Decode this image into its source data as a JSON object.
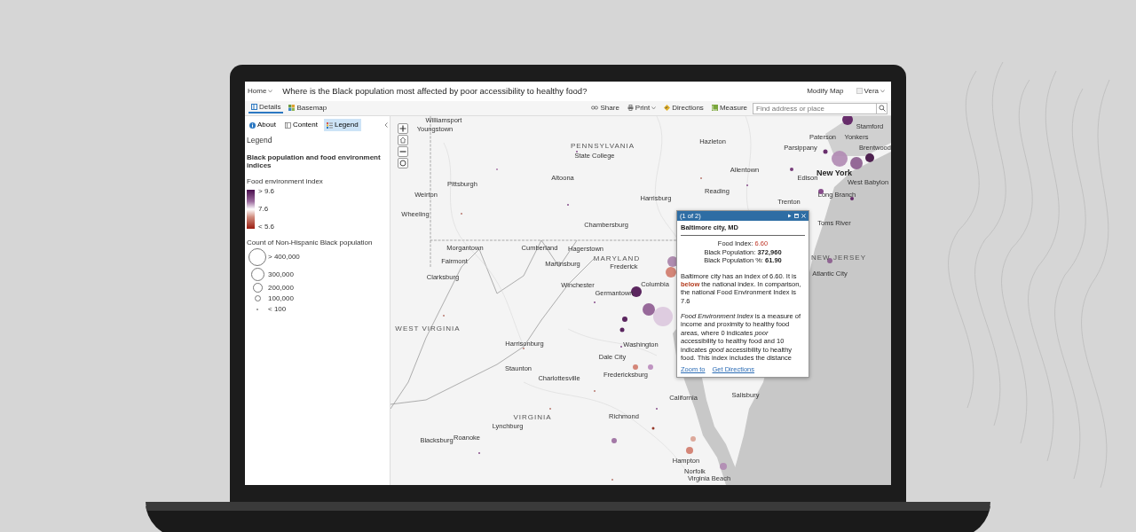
{
  "header": {
    "home": "Home",
    "title": "Where is the Black population most affected by poor accessibility to healthy food?",
    "modify": "Modify Map",
    "user": "Vera"
  },
  "toolbar": {
    "tabs": [
      {
        "label": "Details",
        "kind": "details",
        "selected": true
      },
      {
        "label": "Basemap",
        "kind": "basemap",
        "selected": false
      }
    ],
    "actions": [
      {
        "label": "Share",
        "kind": "share",
        "menu": false
      },
      {
        "label": "Print",
        "kind": "print",
        "menu": true
      },
      {
        "label": "Directions",
        "kind": "directions",
        "menu": false
      },
      {
        "label": "Measure",
        "kind": "measure",
        "menu": false
      }
    ],
    "search": {
      "placeholder": "Find address or place"
    }
  },
  "panel": {
    "tabs": [
      {
        "label": "About",
        "kind": "about",
        "selected": false
      },
      {
        "label": "Content",
        "kind": "content",
        "selected": false
      },
      {
        "label": "Legend",
        "kind": "legend",
        "selected": true
      }
    ],
    "heading": "Legend",
    "layer": "Black population and food environment indices",
    "ramp_title": "Food environment index",
    "ramp_labels": [
      "> 9.6",
      "7.6",
      "< 5.6"
    ],
    "size_title": "Count of Non-Hispanic Black population",
    "sizes": [
      "> 400,000",
      "300,000",
      "200,000",
      "100,000",
      "< 100"
    ]
  },
  "map": {
    "labels": [
      {
        "text": "Williamsport",
        "kind": "city"
      },
      {
        "text": "Stamford",
        "kind": "city"
      },
      {
        "text": "Youngstown",
        "kind": "city"
      },
      {
        "text": "Paterson",
        "kind": "city"
      },
      {
        "text": "Yonkers",
        "kind": "city"
      },
      {
        "text": "Hazleton",
        "kind": "city"
      },
      {
        "text": "PENNSYLVANIA",
        "kind": "state"
      },
      {
        "text": "Parsippany",
        "kind": "city"
      },
      {
        "text": "Brentwood",
        "kind": "city"
      },
      {
        "text": "State College",
        "kind": "city"
      },
      {
        "text": "Allentown",
        "kind": "city"
      },
      {
        "text": "West Babylon",
        "kind": "city"
      },
      {
        "text": "New York",
        "kind": "major"
      },
      {
        "text": "Altoona",
        "kind": "city"
      },
      {
        "text": "Edison",
        "kind": "city"
      },
      {
        "text": "Pittsburgh",
        "kind": "city"
      },
      {
        "text": "Reading",
        "kind": "city"
      },
      {
        "text": "Weirton",
        "kind": "city"
      },
      {
        "text": "Long Branch",
        "kind": "city"
      },
      {
        "text": "Harrisburg",
        "kind": "city"
      },
      {
        "text": "Trenton",
        "kind": "city"
      },
      {
        "text": "Wheeling",
        "kind": "city"
      },
      {
        "text": "Toms River",
        "kind": "city"
      },
      {
        "text": "Chambersburg",
        "kind": "city"
      },
      {
        "text": "Morgantown",
        "kind": "city"
      },
      {
        "text": "Cumberland",
        "kind": "city"
      },
      {
        "text": "Hagerstown",
        "kind": "city"
      },
      {
        "text": "NEW JERSEY",
        "kind": "state"
      },
      {
        "text": "MARYLAND",
        "kind": "state"
      },
      {
        "text": "Fairmont",
        "kind": "city"
      },
      {
        "text": "Martinsburg",
        "kind": "city"
      },
      {
        "text": "Frederick",
        "kind": "city"
      },
      {
        "text": "Atlantic City",
        "kind": "city"
      },
      {
        "text": "Clarksburg",
        "kind": "city"
      },
      {
        "text": "Columbia",
        "kind": "city"
      },
      {
        "text": "Winchester",
        "kind": "city"
      },
      {
        "text": "Germantown",
        "kind": "city"
      },
      {
        "text": "WEST VIRGINIA",
        "kind": "state"
      },
      {
        "text": "Washington",
        "kind": "city"
      },
      {
        "text": "Dale City",
        "kind": "city"
      },
      {
        "text": "Harrisonburg",
        "kind": "city"
      },
      {
        "text": "Fredericksburg",
        "kind": "city"
      },
      {
        "text": "Staunton",
        "kind": "city"
      },
      {
        "text": "Charlottesville",
        "kind": "city"
      },
      {
        "text": "Salisbury",
        "kind": "city"
      },
      {
        "text": "California",
        "kind": "city"
      },
      {
        "text": "Richmond",
        "kind": "city"
      },
      {
        "text": "VIRGINIA",
        "kind": "state"
      },
      {
        "text": "Lynchburg",
        "kind": "city"
      },
      {
        "text": "Roanoke",
        "kind": "city"
      },
      {
        "text": "Blacksburg",
        "kind": "city"
      },
      {
        "text": "Hampton",
        "kind": "city"
      },
      {
        "text": "Norfolk",
        "kind": "city"
      },
      {
        "text": "Virginia Beach",
        "kind": "city"
      }
    ]
  },
  "popup": {
    "counter": "(1 of 2)",
    "title": "Baltimore city, MD",
    "fields": [
      {
        "label": "Food Index:",
        "value": "6.60",
        "kind": "index"
      },
      {
        "label": "Black Population:",
        "value": "372,960",
        "kind": "count"
      },
      {
        "label": "Black Population %:",
        "value": "61.90",
        "kind": "count"
      }
    ],
    "paragraphs": [
      "Baltimore city has an index of 6.60. It is **below** the national index. In comparison, the national Food Environment Index is 7.6",
      "*Food Environment Index* is a measure of income and proximity to healthy food areas, where 0 indicates *poor* accessibility to healthy food and 10 indicates *good* accessibility to healthy food. This index includes the distance"
    ],
    "links": [
      "Zoom to",
      "Get Directions"
    ]
  }
}
